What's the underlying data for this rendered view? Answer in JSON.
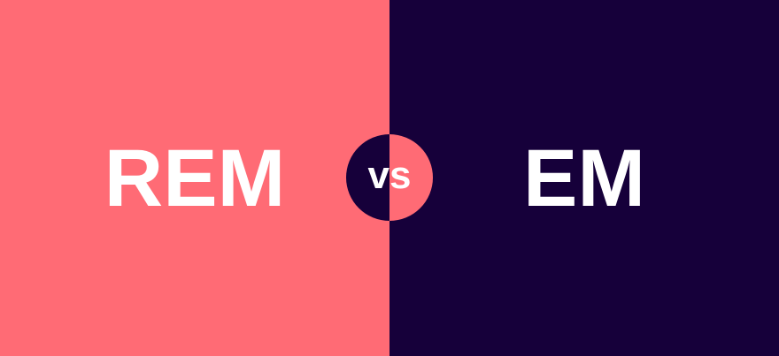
{
  "colors": {
    "left_background": "#ff6b75",
    "right_background": "#16003a",
    "text": "#ffffff"
  },
  "left_label": "REM",
  "right_label": "EM",
  "badge_label": "vs"
}
